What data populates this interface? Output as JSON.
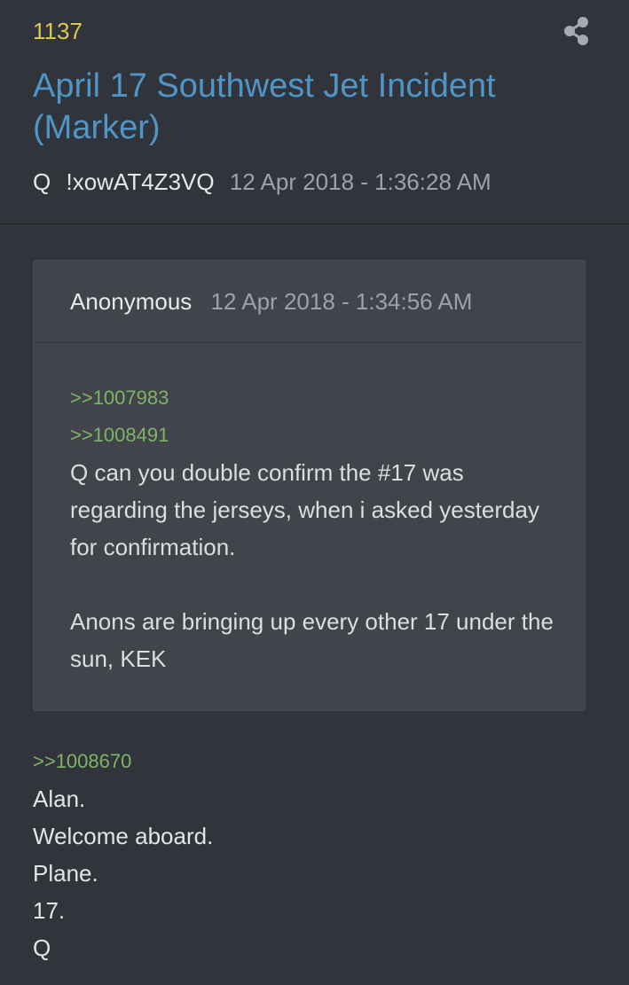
{
  "post": {
    "number": "1137",
    "title": "April 17 Southwest Jet Incident (Marker)",
    "author": "Q",
    "tripcode": "!xowAT4Z3VQ",
    "timestamp": "12 Apr 2018 - 1:36:28 AM",
    "share_icon": "share-icon"
  },
  "quote": {
    "author": "Anonymous",
    "timestamp": "12 Apr 2018 - 1:34:56 AM",
    "links": [
      ">>1007983",
      ">>1008491"
    ],
    "paragraphs": [
      "Q can you double confirm the #17 was regarding the jerseys, when i asked yesterday for confirmation.",
      "Anons are bringing up every other 17 under the sun, KEK"
    ]
  },
  "reply": {
    "link": ">>1008670",
    "lines": [
      "Alan.",
      "Welcome aboard.",
      "Plane.",
      "17.",
      "Q"
    ]
  },
  "colors": {
    "background": "#31343b",
    "post_number": "#dcc94a",
    "title": "#4f95c6",
    "link": "#7fb365",
    "quote_box": "#41444b"
  }
}
